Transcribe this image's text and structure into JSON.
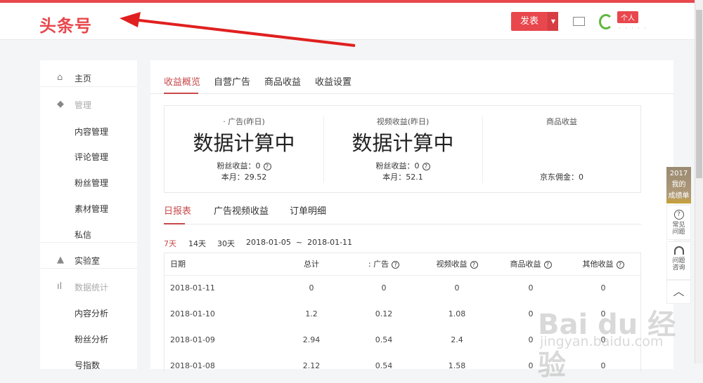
{
  "header": {
    "logo": "头条号",
    "publish": "发表",
    "badge": "个人",
    "username": "· · · · ·"
  },
  "sidebar": [
    {
      "icon": "home-icon",
      "glyph": "⌂",
      "label": "主页",
      "grey": false
    },
    {
      "icon": "cube-icon",
      "glyph": "◆",
      "label": "管理",
      "grey": true
    },
    {
      "label": "内容管理"
    },
    {
      "label": "评论管理"
    },
    {
      "label": "粉丝管理"
    },
    {
      "label": "素材管理"
    },
    {
      "label": "私信"
    },
    {
      "icon": "flask-icon",
      "glyph": "▲",
      "label": "实验室",
      "grey": false
    },
    {
      "icon": "bar-chart-icon",
      "glyph": "ıl",
      "label": "数据统计",
      "grey": true
    },
    {
      "label": "内容分析"
    },
    {
      "label": "粉丝分析"
    },
    {
      "label": "号指数"
    }
  ],
  "tabs": [
    "收益概览",
    "自营广告",
    "商品收益",
    "收益设置"
  ],
  "stats": [
    {
      "title": "· 广告(昨日)",
      "big": "数据计算中",
      "line1": "粉丝收益：0",
      "line2": "本月：29.52"
    },
    {
      "title": "视频收益(昨日)",
      "big": "数据计算中",
      "line1": "粉丝收益：0",
      "line2": "本月：52.1"
    },
    {
      "title": "商品收益",
      "big": "",
      "line1": "",
      "line2": "京东佣金：0"
    }
  ],
  "subtabs": [
    "日报表",
    "广告视频收益",
    "订单明细"
  ],
  "filters": {
    "d7": "7天",
    "d14": "14天",
    "d30": "30天",
    "range": "2018-01-05  ~  2018-01-11"
  },
  "table": {
    "headers": [
      "日期",
      "总计",
      ": 广告",
      "视频收益",
      "商品收益",
      "其他收益"
    ],
    "rows": [
      [
        "2018-01-11",
        "0",
        "0",
        "0",
        "0",
        "0"
      ],
      [
        "2018-01-10",
        "1.2",
        "0.12",
        "1.08",
        "0",
        "0"
      ],
      [
        "2018-01-09",
        "2.94",
        "0.54",
        "2.4",
        "0",
        "0"
      ],
      [
        "2018-01-08",
        "2.12",
        "0.54",
        "1.58",
        "0",
        "0"
      ]
    ]
  },
  "float": {
    "year": "2017",
    "l1": "我的",
    "l2": "成绩单",
    "faq": "常见问题",
    "consult": "问题咨询"
  },
  "watermark": {
    "main": "Bai du 经验",
    "url": "jingyan.baidu.com"
  },
  "colors": {
    "brand": "#e8474d",
    "active_tab": "#c84a4a",
    "arrow": "#e02020"
  }
}
